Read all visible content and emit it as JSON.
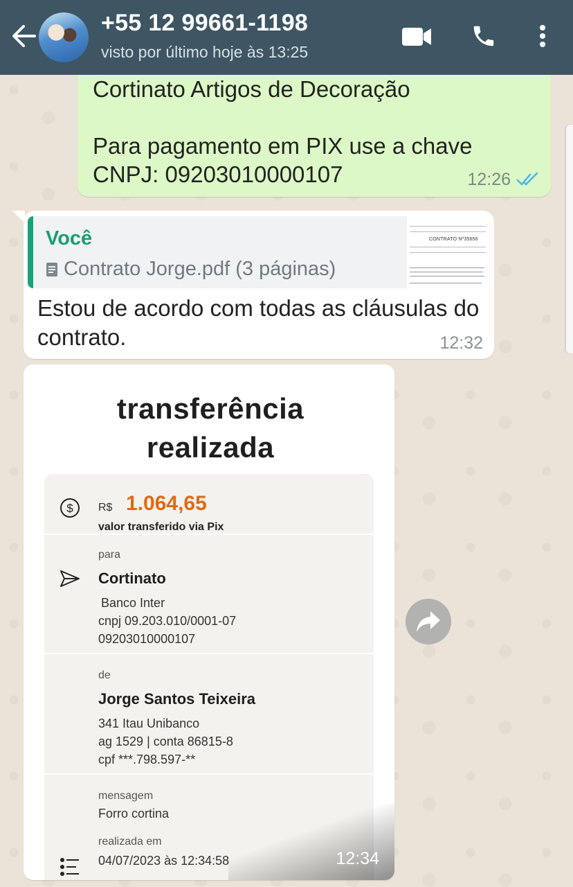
{
  "header": {
    "contact_name": "+55 12 99661-1198",
    "last_seen": "visto por último hoje às 13:25",
    "icons": [
      "back-arrow-icon",
      "video-call-icon",
      "phone-icon",
      "more-vertical-icon"
    ]
  },
  "messages": {
    "outgoing": {
      "text": "Cortinato Artigos de Decoração\n\nPara pagamento em PIX use a chave\nCNPJ: 09203010000107",
      "time": "12:26",
      "status": "read"
    },
    "incoming_reply": {
      "quote_author": "Você",
      "quote_file": "Contrato Jorge.pdf (3 páginas)",
      "quote_thumb_title": "CONTRATO Nº35656",
      "text": "Estou de acordo com todas as cláusulas do contrato.",
      "time": "12:32"
    },
    "image_message": {
      "time": "12:34",
      "receipt": {
        "title": "transferência\nrealizada",
        "currency": "R$",
        "amount": "1.064,65",
        "amount_note": "valor transferido via Pix",
        "to_label": "para",
        "to_name": "Cortinato",
        "to_bank": "Banco Inter",
        "to_cnpj": "cnpj 09.203.010/0001-07",
        "to_key": "09203010000107",
        "from_label": "de",
        "from_name": "Jorge Santos Teixeira",
        "from_bank": "341 Itau Unibanco",
        "from_account": "ag 1529 | conta 86815-8",
        "from_cpf": "cpf ***.798.597-**",
        "message_label": "mensagem",
        "message_text": "Forro cortina",
        "date_label": "realizada em",
        "date_value": "04/07/2023 às 12:34:58"
      }
    }
  },
  "colors": {
    "header_bg": "#3e5663",
    "outgoing_bubble": "#dcf8c6",
    "quote_accent": "#1b9d74",
    "read_ticks": "#4fb6ec",
    "amount": "#e06a13"
  }
}
